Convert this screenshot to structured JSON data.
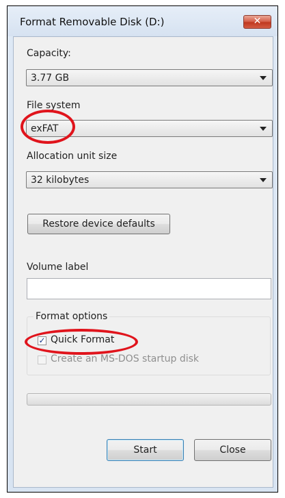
{
  "window": {
    "title": "Format Removable Disk (D:)",
    "close_icon": "close-icon"
  },
  "capacity": {
    "label": "Capacity:",
    "value": "3.77 GB"
  },
  "file_system": {
    "label": "File system",
    "value": "exFAT"
  },
  "allocation": {
    "label": "Allocation unit size",
    "value": "32 kilobytes"
  },
  "restore_button": {
    "label": "Restore device defaults"
  },
  "volume_label": {
    "label": "Volume label",
    "value": ""
  },
  "format_options": {
    "title": "Format options",
    "quick_format": {
      "label": "Quick Format",
      "checked": true
    },
    "msdos_startup": {
      "label": "Create an MS-DOS startup disk",
      "checked": false,
      "enabled": false
    }
  },
  "progress": {
    "fraction": 0
  },
  "buttons": {
    "start": "Start",
    "close": "Close"
  },
  "annotation_color": "#e0141c"
}
